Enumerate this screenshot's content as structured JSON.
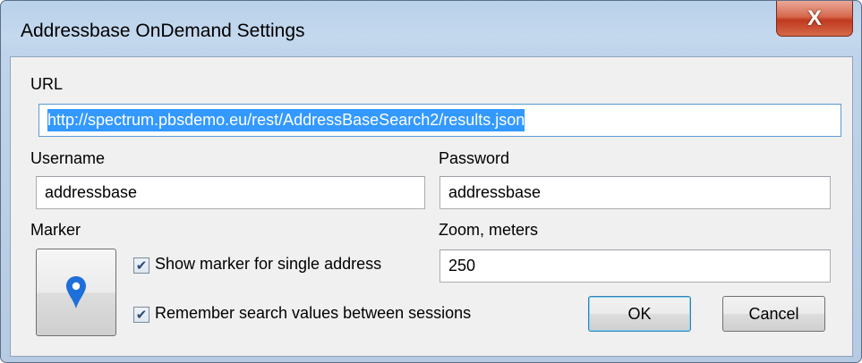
{
  "window": {
    "title": "Addressbase OnDemand Settings",
    "close_glyph": "X"
  },
  "url": {
    "label": "URL",
    "value": "http://spectrum.pbsdemo.eu/rest/AddressBaseSearch2/results.json"
  },
  "username": {
    "label": "Username",
    "value": "addressbase"
  },
  "password": {
    "label": "Password",
    "value": "addressbase"
  },
  "marker": {
    "label": "Marker",
    "icon": "map-pin-icon",
    "icon_color": "#1e6fd9"
  },
  "zoom": {
    "label": "Zoom, meters",
    "value": "250"
  },
  "options": {
    "show_marker_label": "Show marker for single address",
    "show_marker_checked": true,
    "remember_label": "Remember search values between sessions",
    "remember_checked": true
  },
  "buttons": {
    "ok": "OK",
    "cancel": "Cancel"
  }
}
